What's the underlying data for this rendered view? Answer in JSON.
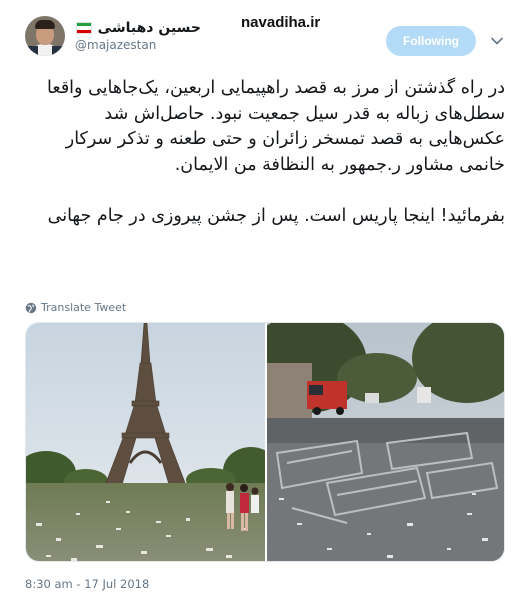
{
  "tweet": {
    "author": {
      "display_name": "حسین دهباشی",
      "handle": "@majazestan",
      "flag_icon": "iran-flag-icon",
      "flag_colors": [
        "#239f40",
        "#ffffff",
        "#da0000"
      ]
    },
    "follow_button_label": "Following",
    "body_paragraph_1": "در راه گذشتن از مرز به قصد راهپیمایی اربعین، یک‌جاهایی واقعا سطل‌های زباله به قدر سیل جمعیت نبود. حاصل‌اش شد عکس‌هایی به قصد تمسخر زائران و حتی طعنه و تذکر سرکار خانمی مشاور ر.جمهور به النظافة من الایمان.",
    "body_paragraph_2": "بفرمائید! اینجا پاریس است. پس از جشن پیروزی در جام جهانی",
    "translate_label": "Translate Tweet",
    "timestamp": "8:30 am - 17 Jul 2018",
    "media": [
      {
        "icon": "eiffel-tower-litter-photo"
      },
      {
        "icon": "street-litter-barriers-photo"
      }
    ]
  },
  "watermark": "navadiha.ir",
  "colors": {
    "follow_button_bg": "#b3dbf7",
    "secondary_text": "#657786",
    "primary_text": "#14171a"
  }
}
